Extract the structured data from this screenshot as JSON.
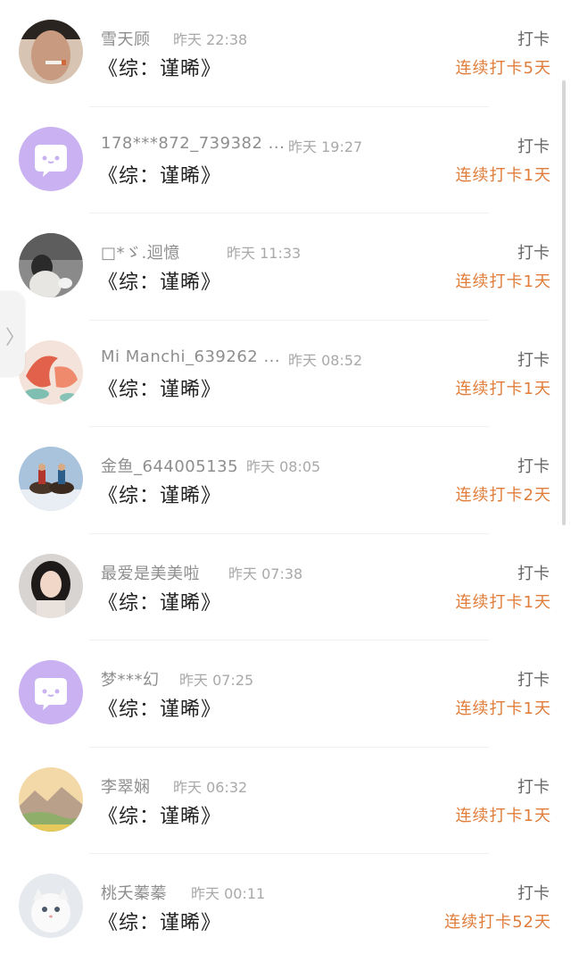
{
  "rows": [
    {
      "username": "雪天顾",
      "time": "昨天 22:38",
      "title": "《综：谨晞》",
      "checkin_label": "打卡",
      "streak": "连续打卡5天",
      "avatar": "man-photo"
    },
    {
      "username": "178***872_739382 ...",
      "time": "昨天 19:27",
      "title": "《综：谨晞》",
      "checkin_label": "打卡",
      "streak": "连续打卡1天",
      "avatar": "default-chat-bubble"
    },
    {
      "username": "□*ゞ.迴憶",
      "time": "昨天 11:33",
      "title": "《综：谨晞》",
      "checkin_label": "打卡",
      "streak": "连续打卡1天",
      "avatar": "person-with-cat"
    },
    {
      "username": "Mi Manchi_639262 ...",
      "time": "昨天 08:52",
      "title": "《综：谨晞》",
      "checkin_label": "打卡",
      "streak": "连续打卡1天",
      "avatar": "koi-painting"
    },
    {
      "username": "金鱼_644005135",
      "time": "昨天 08:05",
      "title": "《综：谨晞》",
      "checkin_label": "打卡",
      "streak": "连续打卡2天",
      "avatar": "horse-riders"
    },
    {
      "username": "最爱是美美啦",
      "time": "昨天 07:38",
      "title": "《综：谨晞》",
      "checkin_label": "打卡",
      "streak": "连续打卡1天",
      "avatar": "woman-portrait"
    },
    {
      "username": "梦***幻",
      "time": "昨天 07:25",
      "title": "《综：谨晞》",
      "checkin_label": "打卡",
      "streak": "连续打卡1天",
      "avatar": "default-chat-bubble"
    },
    {
      "username": "李翠娴",
      "time": "昨天 06:32",
      "title": "《综：谨晞》",
      "checkin_label": "打卡",
      "streak": "连续打卡1天",
      "avatar": "mountain-landscape"
    },
    {
      "username": "桃夭蓁蓁",
      "time": "昨天 00:11",
      "title": "《综：谨晞》",
      "checkin_label": "打卡",
      "streak": "连续打卡52天",
      "avatar": "white-kitten"
    }
  ],
  "side_handle": {
    "icon": "chevron-right-icon",
    "glyph": "〉"
  },
  "colors": {
    "streak": "#e07d3a",
    "default_avatar": "#c9b1f2"
  }
}
